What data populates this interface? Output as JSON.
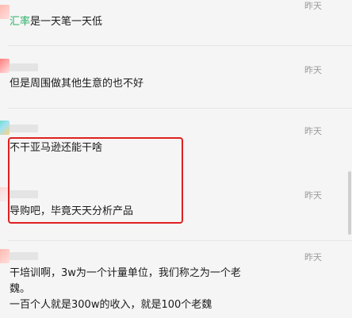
{
  "messages": [
    {
      "time": "昨天",
      "text_highlight": "汇率",
      "text_rest": "是一天笔一天低"
    },
    {
      "time": "昨天",
      "text": "但是周围做其他生意的也不好"
    },
    {
      "time": "昨天",
      "text": "不干亚马逊还能干啥"
    },
    {
      "time": "昨天",
      "text": "导购吧，毕竟天天分析产品"
    },
    {
      "time": "昨天",
      "lines": [
        "干培训啊，3w为一个计量单位，我们称之为一个老",
        "魏。",
        "一百个人就是300w的收入，就是100个老魏"
      ]
    }
  ],
  "colors": {
    "highlight_word": "#2aae67",
    "annotation_box": "#e02020",
    "background": "#f5f5f5"
  },
  "icons": {
    "avatar": "user-avatar"
  }
}
